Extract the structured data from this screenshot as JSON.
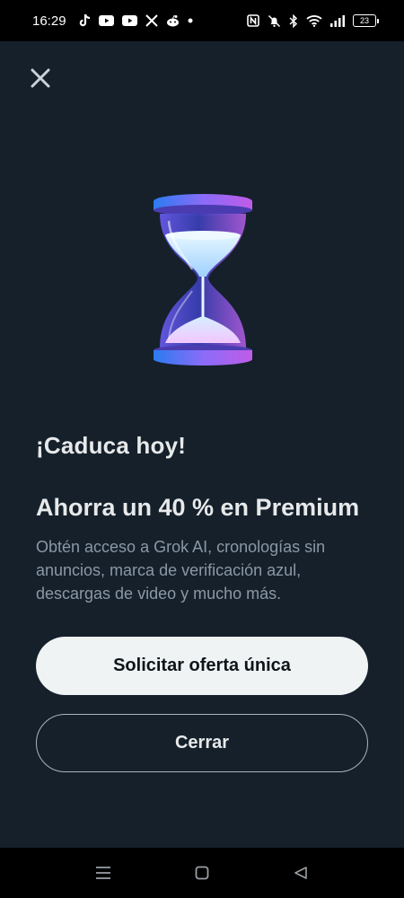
{
  "status_bar": {
    "time": "16:29",
    "left_icons": [
      "tiktok-icon",
      "youtube-icon",
      "youtube-icon",
      "x-icon",
      "reddit-icon",
      "dot-icon"
    ],
    "right_icons": [
      "nfc-icon",
      "mute-icon",
      "bluetooth-icon",
      "wifi-icon",
      "signal-icon"
    ],
    "battery_level": "23"
  },
  "dialog": {
    "close_icon": "close-icon",
    "hero_icon": "hourglass-icon",
    "expiry_title": "¡Caduca hoy!",
    "headline": "Ahorra un 40 % en Premium",
    "description": "Obtén acceso a Grok AI, cronologías sin anuncios, marca de verificación azul, descargas de video y mucho más.",
    "primary_button": "Solicitar oferta única",
    "secondary_button": "Cerrar"
  },
  "nav_bar": {
    "icons": [
      "menu-icon",
      "home-icon",
      "back-icon"
    ]
  },
  "colors": {
    "background": "#15202b",
    "text_primary": "#e7e9ea",
    "text_secondary": "#8b98a5",
    "button_primary_bg": "#eff3f4"
  }
}
